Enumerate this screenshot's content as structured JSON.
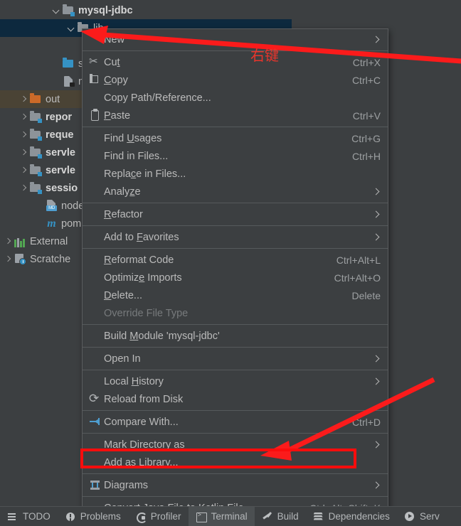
{
  "tree": {
    "rows": [
      {
        "label": "mysql-jdbc",
        "icon": "module-folder-icon",
        "twisty": "down",
        "indent": 72,
        "bold": true,
        "state": "normal"
      },
      {
        "label": "lib",
        "icon": "folder-icon",
        "twisty": "down",
        "indent": 93,
        "bold": false,
        "state": "selected"
      },
      {
        "label": "",
        "icon": "jar-file-icon",
        "twisty": "none",
        "indent": 98,
        "bold": false,
        "state": "normal"
      },
      {
        "label": "src",
        "icon": "source-folder-icon",
        "twisty": "none",
        "indent": 72,
        "bold": false,
        "state": "normal"
      },
      {
        "label": "my",
        "icon": "file-icon",
        "twisty": "none",
        "indent": 72,
        "bold": false,
        "state": "normal"
      },
      {
        "label": "out",
        "icon": "out-folder-icon",
        "twisty": "right",
        "indent": 26,
        "bold": false,
        "state": "out"
      },
      {
        "label": "repor",
        "icon": "module-folder-icon",
        "twisty": "right",
        "indent": 26,
        "bold": true,
        "state": "normal"
      },
      {
        "label": "reque",
        "icon": "module-folder-icon",
        "twisty": "right",
        "indent": 26,
        "bold": true,
        "state": "normal"
      },
      {
        "label": "servle",
        "icon": "module-folder-icon",
        "twisty": "right",
        "indent": 26,
        "bold": true,
        "state": "normal"
      },
      {
        "label": "servle",
        "icon": "module-folder-icon",
        "twisty": "right",
        "indent": 26,
        "bold": true,
        "state": "normal"
      },
      {
        "label": "sessio",
        "icon": "module-folder-icon",
        "twisty": "right",
        "indent": 26,
        "bold": true,
        "state": "normal"
      },
      {
        "label": "node.",
        "icon": "markdown-file-icon",
        "twisty": "none",
        "indent": 48,
        "bold": false,
        "state": "normal"
      },
      {
        "label": "pom.x",
        "icon": "maven-file-icon",
        "twisty": "none",
        "indent": 48,
        "bold": false,
        "state": "normal"
      },
      {
        "label": "External",
        "icon": "external-libraries-icon",
        "twisty": "right",
        "indent": 4,
        "bold": false,
        "state": "normal"
      },
      {
        "label": "Scratche",
        "icon": "scratches-icon",
        "twisty": "right",
        "indent": 4,
        "bold": false,
        "state": "normal"
      }
    ],
    "md_tag": "MD",
    "maven_glyph": "m"
  },
  "context_menu": {
    "items": [
      {
        "label": "New",
        "shortcut": "",
        "icon": "",
        "submenu": true,
        "disabled": false,
        "sep_after": true,
        "highlight": false
      },
      {
        "label": "Cut",
        "shortcut": "Ctrl+X",
        "icon": "cut-icon",
        "submenu": false,
        "disabled": false,
        "sep_after": false,
        "highlight": false
      },
      {
        "label": "Copy",
        "shortcut": "Ctrl+C",
        "icon": "copy-icon",
        "submenu": false,
        "disabled": false,
        "sep_after": false,
        "highlight": false
      },
      {
        "label": "Copy Path/Reference...",
        "shortcut": "",
        "icon": "",
        "submenu": false,
        "disabled": false,
        "sep_after": false,
        "highlight": false
      },
      {
        "label": "Paste",
        "shortcut": "Ctrl+V",
        "icon": "paste-icon",
        "submenu": false,
        "disabled": false,
        "sep_after": true,
        "highlight": false
      },
      {
        "label": "Find Usages",
        "shortcut": "Ctrl+G",
        "icon": "",
        "submenu": false,
        "disabled": false,
        "sep_after": false,
        "highlight": false
      },
      {
        "label": "Find in Files...",
        "shortcut": "Ctrl+H",
        "icon": "",
        "submenu": false,
        "disabled": false,
        "sep_after": false,
        "highlight": false
      },
      {
        "label": "Replace in Files...",
        "shortcut": "",
        "icon": "",
        "submenu": false,
        "disabled": false,
        "sep_after": false,
        "highlight": false
      },
      {
        "label": "Analyze",
        "shortcut": "",
        "icon": "",
        "submenu": true,
        "disabled": false,
        "sep_after": true,
        "highlight": false
      },
      {
        "label": "Refactor",
        "shortcut": "",
        "icon": "",
        "submenu": true,
        "disabled": false,
        "sep_after": true,
        "highlight": false
      },
      {
        "label": "Add to Favorites",
        "shortcut": "",
        "icon": "",
        "submenu": true,
        "disabled": false,
        "sep_after": true,
        "highlight": false
      },
      {
        "label": "Reformat Code",
        "shortcut": "Ctrl+Alt+L",
        "icon": "",
        "submenu": false,
        "disabled": false,
        "sep_after": false,
        "highlight": false
      },
      {
        "label": "Optimize Imports",
        "shortcut": "Ctrl+Alt+O",
        "icon": "",
        "submenu": false,
        "disabled": false,
        "sep_after": false,
        "highlight": false
      },
      {
        "label": "Delete...",
        "shortcut": "Delete",
        "icon": "",
        "submenu": false,
        "disabled": false,
        "sep_after": false,
        "highlight": false
      },
      {
        "label": "Override File Type",
        "shortcut": "",
        "icon": "",
        "submenu": false,
        "disabled": true,
        "sep_after": true,
        "highlight": false
      },
      {
        "label": "Build Module 'mysql-jdbc'",
        "shortcut": "",
        "icon": "",
        "submenu": false,
        "disabled": false,
        "sep_after": true,
        "highlight": false
      },
      {
        "label": "Open In",
        "shortcut": "",
        "icon": "",
        "submenu": true,
        "disabled": false,
        "sep_after": true,
        "highlight": false
      },
      {
        "label": "Local History",
        "shortcut": "",
        "icon": "",
        "submenu": true,
        "disabled": false,
        "sep_after": false,
        "highlight": false
      },
      {
        "label": "Reload from Disk",
        "shortcut": "",
        "icon": "reload-icon",
        "submenu": false,
        "disabled": false,
        "sep_after": true,
        "highlight": false
      },
      {
        "label": "Compare With...",
        "shortcut": "Ctrl+D",
        "icon": "compare-icon",
        "submenu": false,
        "disabled": false,
        "sep_after": true,
        "highlight": false
      },
      {
        "label": "Mark Directory as",
        "shortcut": "",
        "icon": "",
        "submenu": true,
        "disabled": false,
        "sep_after": false,
        "highlight": false
      },
      {
        "label": "Add as Library...",
        "shortcut": "",
        "icon": "",
        "submenu": false,
        "disabled": false,
        "sep_after": true,
        "highlight": true
      },
      {
        "label": "Diagrams",
        "shortcut": "",
        "icon": "diagrams-icon",
        "submenu": true,
        "disabled": false,
        "sep_after": true,
        "highlight": false
      },
      {
        "label": "Convert Java File to Kotlin File",
        "shortcut": "Ctrl+Alt+Shift+K",
        "icon": "",
        "submenu": false,
        "disabled": false,
        "sep_after": false,
        "highlight": false
      }
    ]
  },
  "annotations": {
    "red_text": "右键",
    "red_color": "#e8352c",
    "box_color": "#fb0d0d",
    "arrow_to_lib": "arrow pointing to lib folder",
    "arrow_to_add_as_library": "arrow pointing to Add as Library menu item"
  },
  "status_bar": {
    "items": [
      {
        "label": "TODO",
        "icon": "todo-icon",
        "active": false
      },
      {
        "label": "Problems",
        "icon": "problems-icon",
        "active": false
      },
      {
        "label": "Profiler",
        "icon": "profiler-icon",
        "active": false
      },
      {
        "label": "Terminal",
        "icon": "terminal-icon",
        "active": true
      },
      {
        "label": "Build",
        "icon": "build-icon",
        "active": false
      },
      {
        "label": "Dependencies",
        "icon": "dependencies-icon",
        "active": false
      },
      {
        "label": "Serv",
        "icon": "services-icon",
        "active": false
      }
    ]
  }
}
